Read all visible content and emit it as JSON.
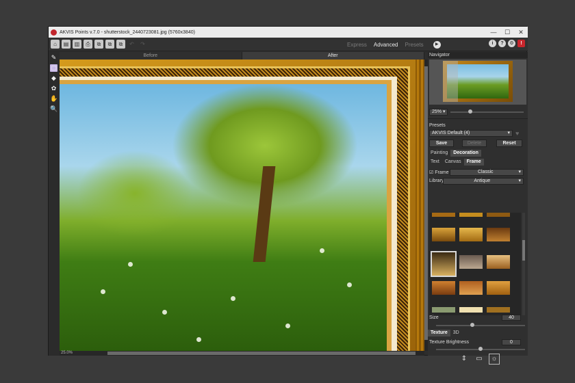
{
  "window": {
    "title": "AKVIS Points v.7.0 - shutterstock_2440723081.jpg (5760x3840)",
    "controls": [
      "—",
      "☐",
      "✕"
    ]
  },
  "toolbar": {
    "buttons": [
      {
        "name": "home-icon",
        "glyph": "⌂"
      },
      {
        "name": "open-icon",
        "glyph": "▤"
      },
      {
        "name": "save-icon",
        "glyph": "▥"
      },
      {
        "name": "print-icon",
        "glyph": "⎙"
      },
      {
        "name": "batch-icon",
        "glyph": "⧉"
      },
      {
        "name": "share-icon",
        "glyph": "⧉"
      },
      {
        "name": "plugin-icon",
        "glyph": "⧉"
      }
    ],
    "undo_glyph": "↶",
    "redo_glyph": "↷",
    "modes": [
      "Express",
      "Advanced",
      "Presets"
    ],
    "active_mode": "Advanced",
    "right_icons": [
      "i",
      "?",
      "⚙",
      "!"
    ]
  },
  "tools": [
    "✎",
    "▢",
    "◆",
    "✿",
    "✋",
    "🔍"
  ],
  "view_tabs": {
    "before": "Before",
    "after": "After"
  },
  "canvas": {
    "zoom_label": "25.0%"
  },
  "panel": {
    "navigator_title": "Navigator",
    "navigator_zoom": "25% ▾",
    "presets_title": "Presets",
    "preset_selected": "AKVIS Default (4)",
    "preset_buttons": {
      "save": "Save",
      "delete": "Delete",
      "reset": "Reset"
    },
    "main_tabs": {
      "painting": "Painting",
      "decoration": "Decoration"
    },
    "sub_tabs": {
      "text": "Text",
      "canvas": "Canvas",
      "frame": "Frame"
    },
    "frame_checkbox": "Frame",
    "frame_type": "Classic",
    "library_label": "Library",
    "library_value": "Antique",
    "size_label": "Size",
    "size_value": "40",
    "texture_tabs": {
      "texture": "Texture",
      "three_d": "3D"
    },
    "brightness_label": "Texture Brightness",
    "brightness_value": "0",
    "bottom_icons": [
      "⇕",
      "▭",
      "☼"
    ]
  }
}
